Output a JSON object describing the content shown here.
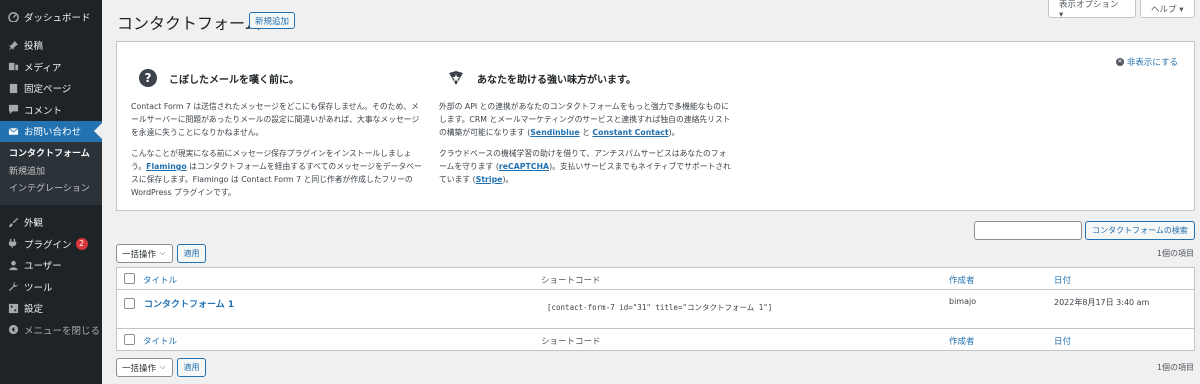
{
  "sidebar": {
    "dashboard": "ダッシュボード",
    "posts": "投稿",
    "media": "メディア",
    "pages": "固定ページ",
    "comments": "コメント",
    "contact": "お問い合わせ",
    "sub_contact_forms": "コンタクトフォーム",
    "sub_add_new": "新規追加",
    "sub_integration": "インテグレーション",
    "appearance": "外観",
    "plugins": "プラグイン",
    "plugins_badge": "2",
    "users": "ユーザー",
    "tools": "ツール",
    "settings": "設定",
    "collapse": "メニューを閉じる"
  },
  "header": {
    "screen_options": "表示オプション ▾",
    "help": "ヘルプ ▾",
    "title": "コンタクトフォーム",
    "add_new": "新規追加"
  },
  "welcome": {
    "dismiss": "非表示にする",
    "left_heading": "こぼしたメールを嘆く前に。",
    "left_p1": "Contact Form 7 は送信されたメッセージをどこにも保存しません。そのため、メールサーバーに問題があったりメールの設定に間違いがあれば、大事なメッセージを永遠に失うことになりかねません。",
    "left_p2_a": "こんなことが現実になる前にメッセージ保存プラグインをインストールしましょう。",
    "left_p2_link": "Flamingo",
    "left_p2_b": " はコンタクトフォームを経由するすべてのメッセージをデータベースに保存します。Flamingo は Contact Form 7 と同じ作者が作成したフリーの WordPress プラグインです。",
    "right_heading": "あなたを助ける強い味方がいます。",
    "right_p1_a": "外部の API との連携があなたのコンタクトフォームをもっと強力で多機能なものにします。CRM とメールマーケティングのサービスと連携すれば独自の連絡先リストの構築が可能になります (",
    "right_p1_link1": "Sendinblue",
    "right_p1_mid": " と ",
    "right_p1_link2": "Constant Contact",
    "right_p1_b": ")。",
    "right_p2_a": "クラウドベースの機械学習の助けを借りて、アンチスパムサービスはあなたのフォームを守ります (",
    "right_p2_link1": "reCAPTCHA",
    "right_p2_b": ")。支払いサービスまでもネイティブでサポートされています (",
    "right_p2_link2": "Stripe",
    "right_p2_c": ")。"
  },
  "search": {
    "button": "コンタクトフォームの検索",
    "value": ""
  },
  "bulk": {
    "label": "一括操作",
    "apply": "適用",
    "count": "1個の項目"
  },
  "table": {
    "columns": {
      "title": "タイトル",
      "shortcode": "ショートコード",
      "author": "作成者",
      "date": "日付"
    },
    "rows": [
      {
        "title": "コンタクトフォーム 1",
        "shortcode": "[contact-form-7 id=\"31\" title=\"コンタクトフォーム 1\"]",
        "author": "bimajo",
        "date": "2022年8月17日 3:40 am"
      }
    ]
  }
}
